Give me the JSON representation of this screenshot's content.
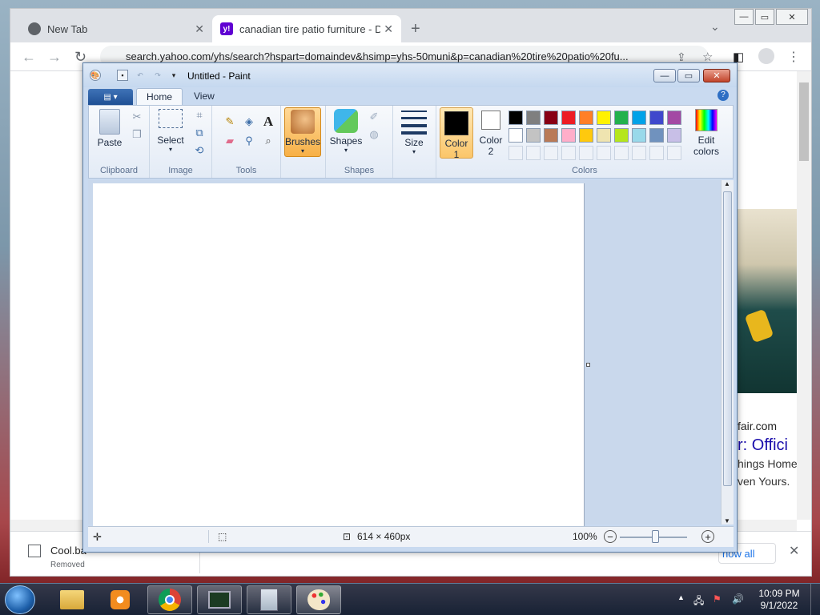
{
  "chrome": {
    "tabs": [
      {
        "label": "New Tab",
        "active": false
      },
      {
        "label": "canadian tire patio furniture - DD",
        "active": true
      }
    ],
    "new_tab_label": "+",
    "address": "search.yahoo.com/yhs/search?hspart=domaindev&hsimp=yhs-50muni&p=canadian%20tire%20patio%20fu...",
    "page_fragments": {
      "domain": "fair.com",
      "headline": "r: Offici",
      "line1": "hings Home",
      "line2": "ven Yours."
    },
    "download": {
      "filename": "Cool.ba",
      "status": "Removed",
      "show_all": "how all"
    }
  },
  "paint": {
    "title": "Untitled - Paint",
    "tabs": {
      "home": "Home",
      "view": "View"
    },
    "groups": {
      "clipboard": "Clipboard",
      "image": "Image",
      "tools": "Tools",
      "shapes": "Shapes",
      "colors": "Colors"
    },
    "buttons": {
      "paste": "Paste",
      "select": "Select",
      "brushes": "Brushes",
      "shapes": "Shapes",
      "size": "Size",
      "color1_line1": "Color",
      "color1_line2": "1",
      "color2_line1": "Color",
      "color2_line2": "2",
      "edit_colors_line1": "Edit",
      "edit_colors_line2": "colors"
    },
    "palette_row1": [
      "#000000",
      "#7f7f7f",
      "#880015",
      "#ed1c24",
      "#ff7f27",
      "#fff200",
      "#22b14c",
      "#00a2e8",
      "#3f48cc",
      "#a349a4"
    ],
    "palette_row2": [
      "#ffffff",
      "#c3c3c3",
      "#b97a57",
      "#ffaec9",
      "#ffc90e",
      "#efe4b0",
      "#b5e61d",
      "#99d9ea",
      "#7092be",
      "#c8bfe7"
    ],
    "color1": "#000000",
    "color2": "#ffffff",
    "status": {
      "image_size": "614 × 460px",
      "zoom": "100%"
    }
  },
  "taskbar": {
    "time": "10:09 PM",
    "date": "9/1/2022"
  }
}
